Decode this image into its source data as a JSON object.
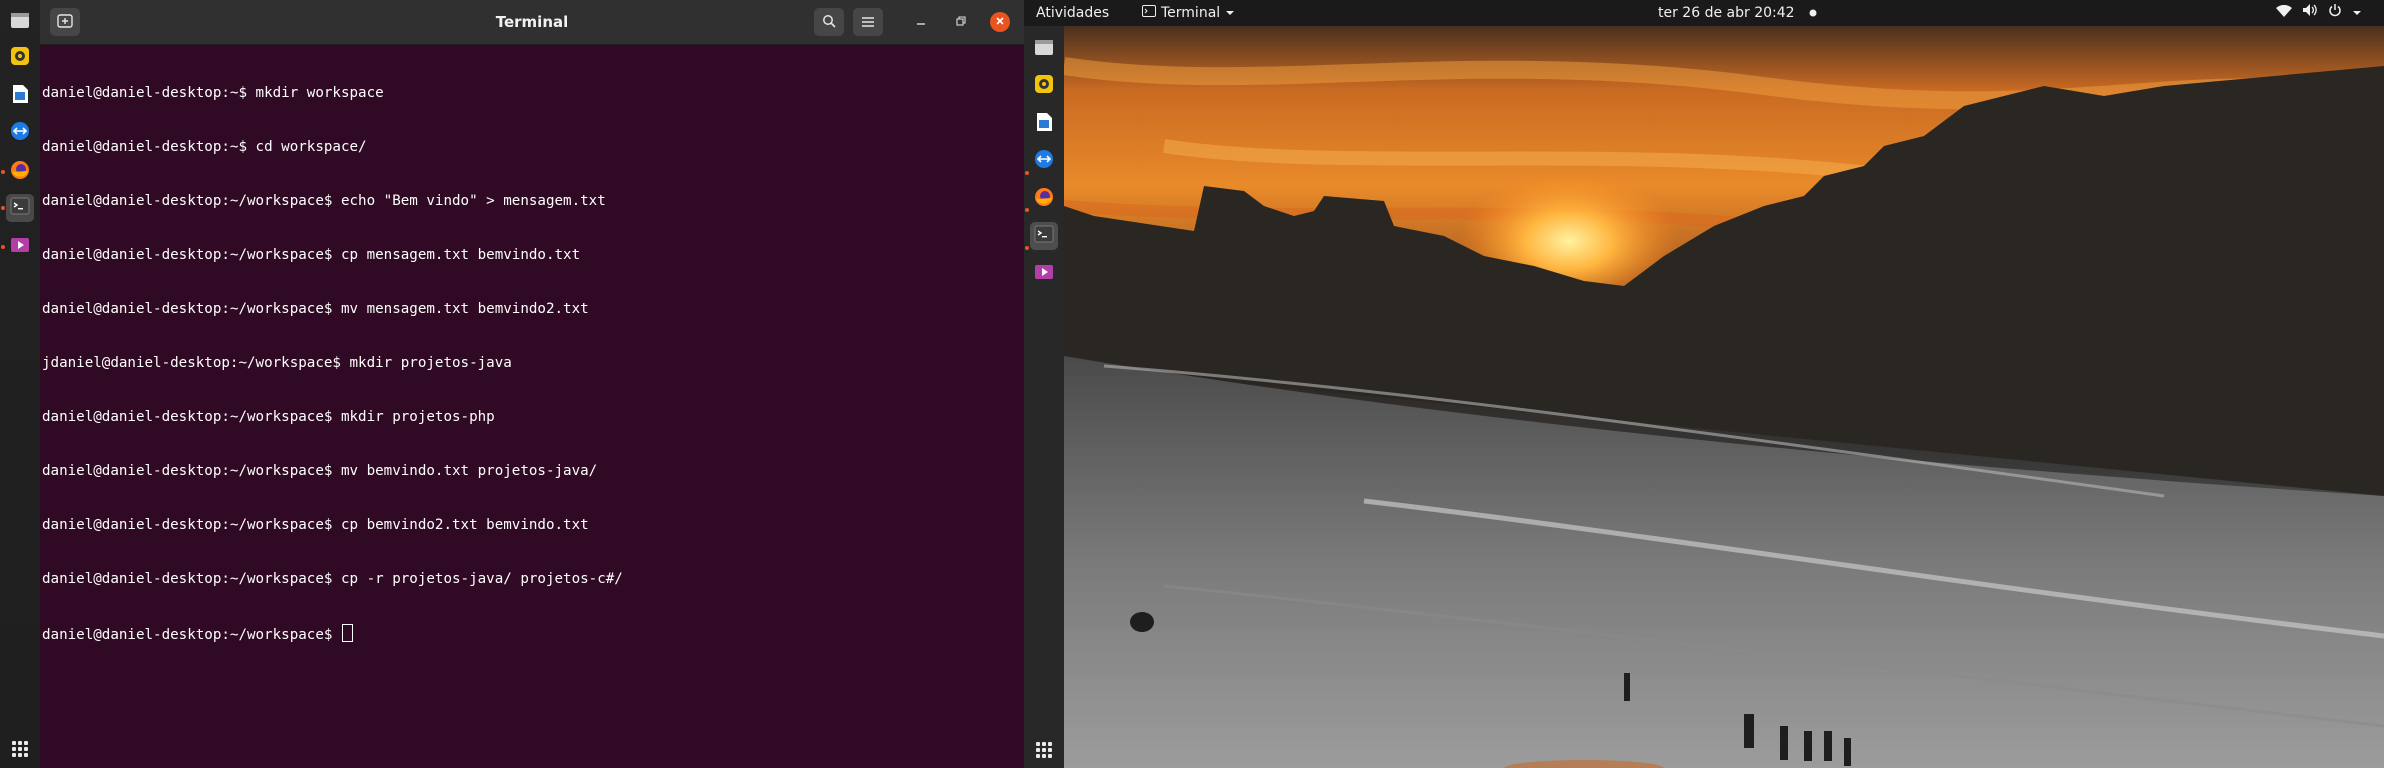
{
  "left_dock": {
    "icons": [
      "files-icon",
      "rhythmbox-icon",
      "libreoffice-writer-icon",
      "teamviewer-icon",
      "firefox-icon",
      "terminal-icon",
      "media-player-icon"
    ],
    "apps_grid": "show-applications-icon"
  },
  "terminal": {
    "title": "Terminal",
    "lines": [
      "daniel@daniel-desktop:~$ mkdir workspace",
      "daniel@daniel-desktop:~$ cd workspace/",
      "daniel@daniel-desktop:~/workspace$ echo \"Bem vindo\" > mensagem.txt",
      "daniel@daniel-desktop:~/workspace$ cp mensagem.txt bemvindo.txt",
      "daniel@daniel-desktop:~/workspace$ mv mensagem.txt bemvindo2.txt",
      "jdaniel@daniel-desktop:~/workspace$ mkdir projetos-java",
      "daniel@daniel-desktop:~/workspace$ mkdir projetos-php",
      "daniel@daniel-desktop:~/workspace$ mv bemvindo.txt projetos-java/",
      "daniel@daniel-desktop:~/workspace$ cp bemvindo2.txt bemvindo.txt",
      "daniel@daniel-desktop:~/workspace$ cp -r projetos-java/ projetos-c#/"
    ],
    "prompt": "daniel@daniel-desktop:~/workspace$ ",
    "colors": {
      "background": "#300a24",
      "header": "#303030",
      "close": "#e95420"
    }
  },
  "topbar": {
    "activities": "Atividades",
    "app_menu": "Terminal",
    "datetime": "ter 26 de abr  20:42",
    "status_icons": [
      "network-icon",
      "volume-icon",
      "power-icon",
      "chevron-down-icon"
    ]
  },
  "right_dock": {
    "icons": [
      "files-icon",
      "rhythmbox-icon",
      "libreoffice-writer-icon",
      "teamviewer-icon",
      "firefox-icon",
      "terminal-icon",
      "media-player-icon"
    ],
    "apps_grid": "show-applications-icon"
  }
}
